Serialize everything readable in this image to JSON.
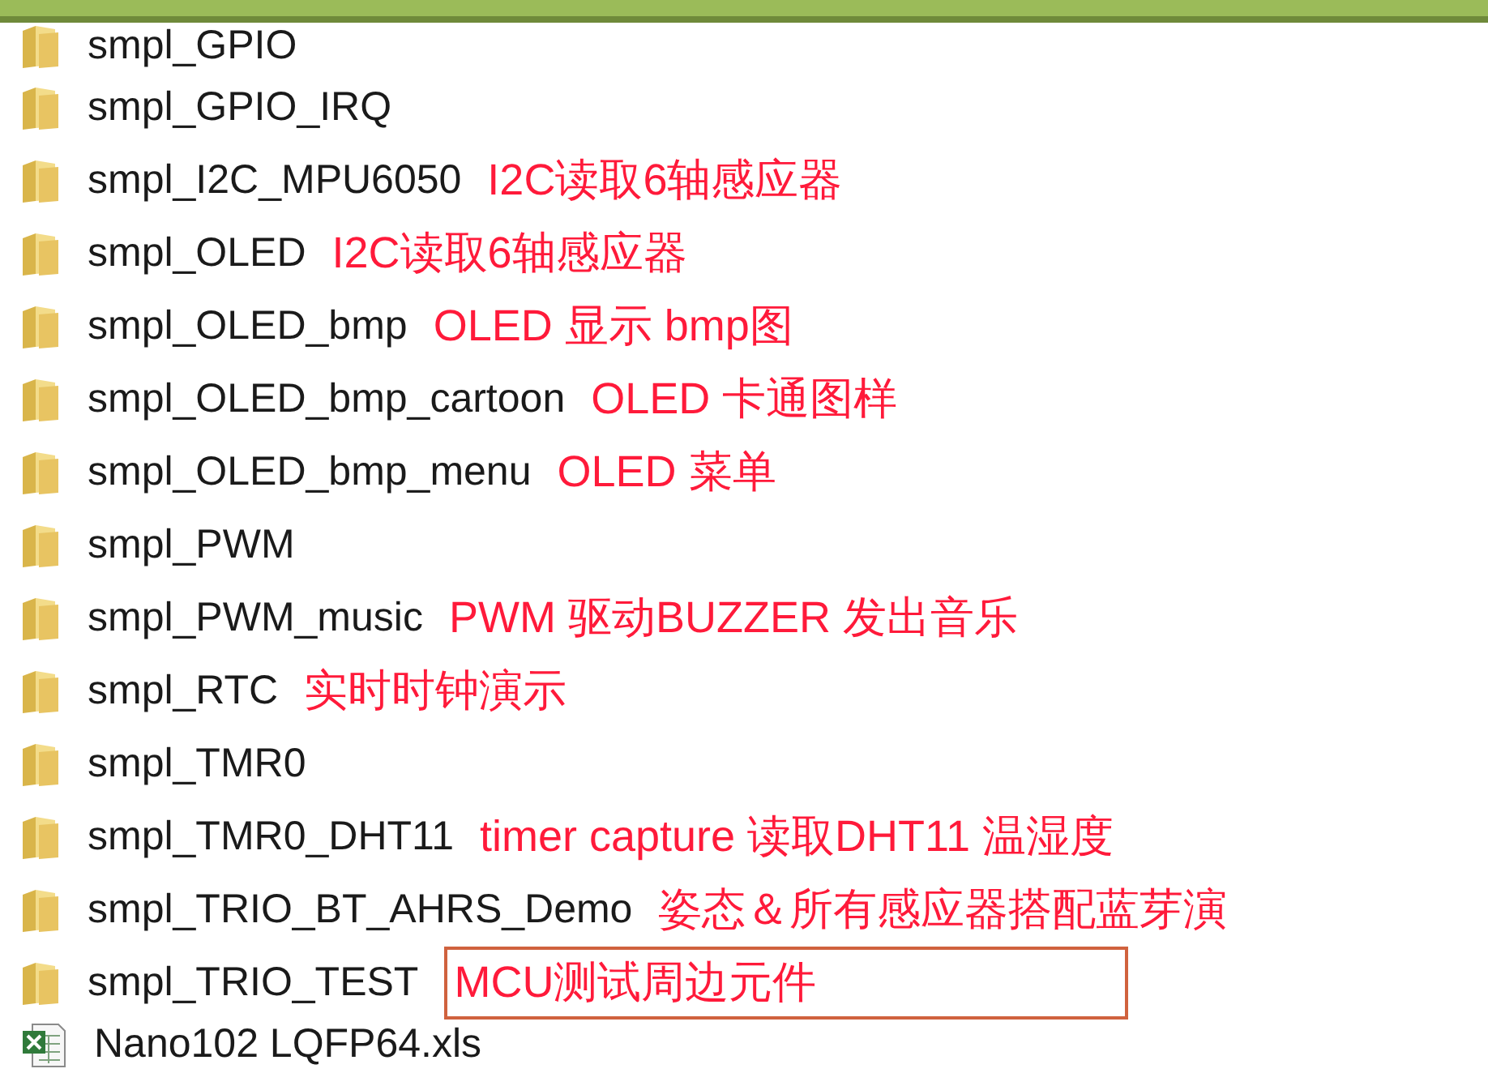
{
  "files": [
    {
      "kind": "folder",
      "name": "smpl_GPIO"
    },
    {
      "kind": "folder",
      "name": "smpl_GPIO_IRQ"
    },
    {
      "kind": "folder",
      "name": "smpl_I2C_MPU6050",
      "note": "I2C读取6轴感应器"
    },
    {
      "kind": "folder",
      "name": "smpl_OLED",
      "note": "I2C读取6轴感应器"
    },
    {
      "kind": "folder",
      "name": "smpl_OLED_bmp",
      "note": "OLED 显示 bmp图"
    },
    {
      "kind": "folder",
      "name": "smpl_OLED_bmp_cartoon",
      "note": "OLED 卡通图样"
    },
    {
      "kind": "folder",
      "name": "smpl_OLED_bmp_menu",
      "note": "OLED 菜单"
    },
    {
      "kind": "folder",
      "name": "smpl_PWM"
    },
    {
      "kind": "folder",
      "name": "smpl_PWM_music",
      "note": "PWM 驱动BUZZER 发出音乐"
    },
    {
      "kind": "folder",
      "name": "smpl_RTC",
      "note": "实时时钟演示"
    },
    {
      "kind": "folder",
      "name": "smpl_TMR0"
    },
    {
      "kind": "folder",
      "name": "smpl_TMR0_DHT11",
      "note": "timer capture 读取DHT11 温湿度"
    },
    {
      "kind": "folder",
      "name": "smpl_TRIO_BT_AHRS_Demo",
      "note": "姿态＆所有感应器搭配蓝芽演"
    },
    {
      "kind": "folder",
      "name": "smpl_TRIO_TEST",
      "note": "MCU测试周边元件",
      "boxed": true
    },
    {
      "kind": "excel",
      "name": "Nano102 LQFP64.xls"
    }
  ]
}
